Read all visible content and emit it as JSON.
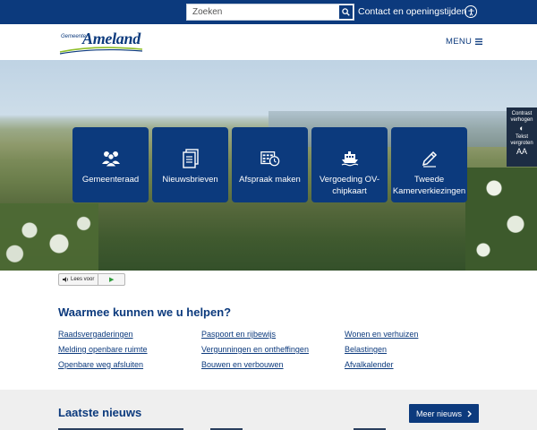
{
  "topbar": {
    "search_placeholder": "Zoeken",
    "contact_link": "Contact en openingstijden"
  },
  "header": {
    "logo_small": "Gemeente",
    "logo_big": "Ameland",
    "menu_label": "MENU"
  },
  "tiles": [
    {
      "label": "Gemeenteraad",
      "icon": "people-icon"
    },
    {
      "label": "Nieuwsbrieven",
      "icon": "documents-icon"
    },
    {
      "label": "Afspraak maken",
      "icon": "calendar-clock-icon"
    },
    {
      "label": "Vergoeding OV-chipkaart",
      "icon": "ferry-icon"
    },
    {
      "label": "Tweede Kamerverkiezingen",
      "icon": "pencil-icon"
    }
  ],
  "side_tools": {
    "contrast": "Contrast verhogen",
    "contrast_symbol": "◐",
    "text_size": "Tekst vergroten",
    "text_symbol": "AA"
  },
  "read_aloud": {
    "label": "Lees voor"
  },
  "help": {
    "title": "Waarmee kunnen we u helpen?",
    "links": [
      "Raadsvergaderingen",
      "Paspoort en rijbewijs",
      "Wonen en verhuizen",
      "Melding openbare ruimte",
      "Vergunningen en ontheffingen",
      "Belastingen",
      "Openbare weg afsluiten",
      "Bouwen en verbouwen",
      "Afvalkalender"
    ]
  },
  "news": {
    "title": "Laatste nieuws",
    "more_button": "Meer nieuws"
  },
  "colors": {
    "primary": "#0c3a7d",
    "news_background": "#efefef"
  }
}
